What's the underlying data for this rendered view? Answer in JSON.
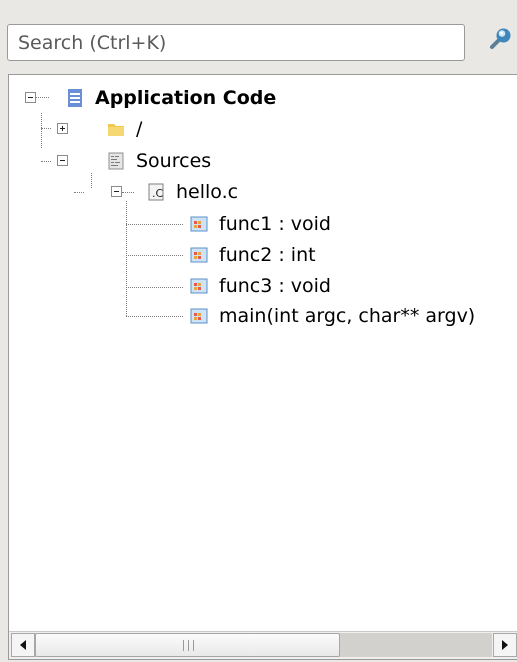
{
  "search": {
    "placeholder": "Search (Ctrl+K)",
    "value": "",
    "icon": "search-icon"
  },
  "tree": {
    "root": {
      "label": "Application Code",
      "icon": "application-code-icon",
      "expanded": true
    },
    "folder": {
      "label": "/",
      "icon": "folder-icon",
      "expanded": false
    },
    "sources": {
      "label": "Sources",
      "icon": "sources-icon",
      "expanded": true
    },
    "file": {
      "label": "hello.c",
      "icon": "c-file-icon",
      "expanded": true
    },
    "functions": [
      {
        "label": "func1 : void",
        "icon": "function-icon"
      },
      {
        "label": "func2 : int",
        "icon": "function-icon"
      },
      {
        "label": "func3 : void",
        "icon": "function-icon"
      },
      {
        "label": "main(int argc, char** argv)",
        "icon": "function-icon"
      }
    ]
  },
  "scrollbar": {
    "orientation": "horizontal",
    "thumb_fraction": 0.66,
    "position": 0
  },
  "colors": {
    "background": "#eae8e4",
    "panel": "#ffffff",
    "border": "#9a9a9a"
  }
}
